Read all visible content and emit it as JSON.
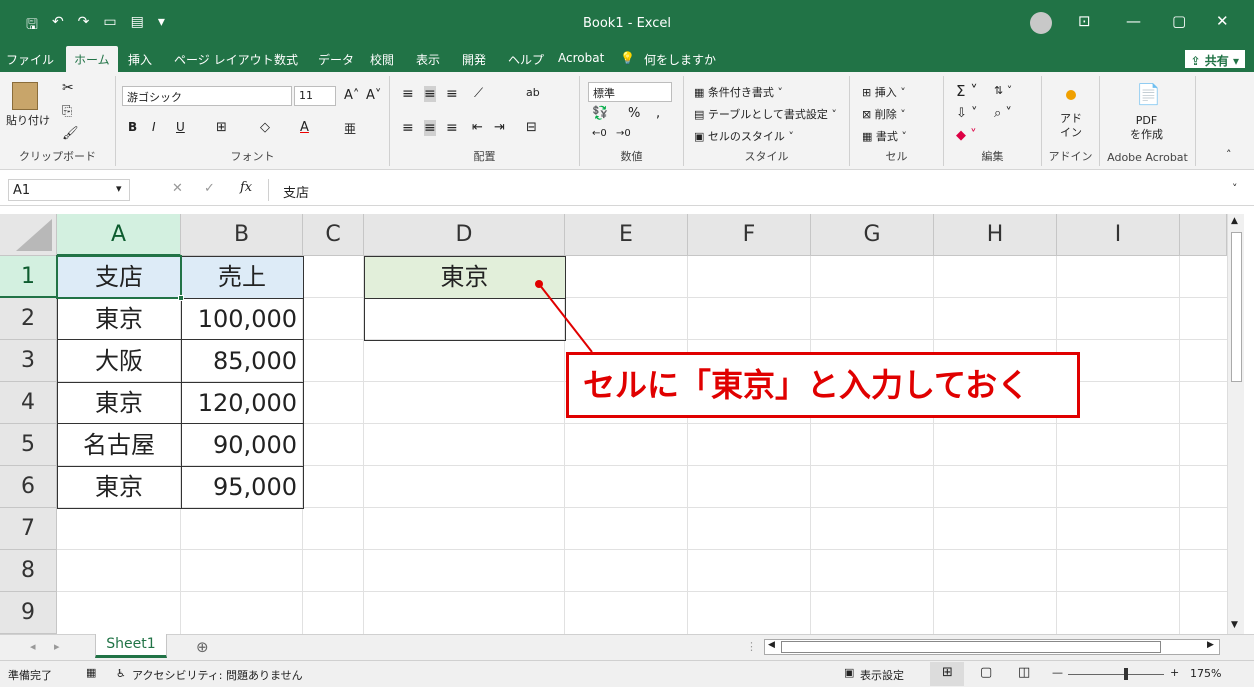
{
  "titlebar": {
    "title": "Book1  -  Excel"
  },
  "menu": {
    "tabs": [
      "ファイル",
      "ホーム",
      "挿入",
      "ページ レイアウト",
      "数式",
      "データ",
      "校閲",
      "表示",
      "開発",
      "ヘルプ",
      "Acrobat"
    ],
    "tell_me": "何をしますか",
    "share": "共有"
  },
  "ribbon": {
    "clipboard": {
      "paste": "貼り付け",
      "label": "クリップボード"
    },
    "font": {
      "name": "游ゴシック",
      "size": "11",
      "label": "フォント"
    },
    "alignment": {
      "label": "配置"
    },
    "number": {
      "format": "標準",
      "label": "数値"
    },
    "styles": {
      "cond": "条件付き書式",
      "table": "テーブルとして書式設定",
      "cell": "セルのスタイル",
      "label": "スタイル"
    },
    "cells": {
      "insert": "挿入",
      "delete": "削除",
      "format": "書式",
      "label": "セル"
    },
    "editing": {
      "label": "編集"
    },
    "addins": {
      "text": "アド\nイン",
      "label": "アドイン"
    },
    "acrobat": {
      "text": "PDF\nを作成",
      "label": "Adobe Acrobat"
    }
  },
  "formula": {
    "namebox": "A1",
    "content": "支店"
  },
  "sheet": {
    "columns": [
      "A",
      "B",
      "C",
      "D",
      "E",
      "F",
      "G",
      "H",
      "I"
    ],
    "rows": [
      "1",
      "2",
      "3",
      "4",
      "5",
      "6",
      "7",
      "8",
      "9"
    ],
    "table": [
      [
        "支店",
        "売上"
      ],
      [
        "東京",
        "100,000"
      ],
      [
        "大阪",
        "85,000"
      ],
      [
        "東京",
        "120,000"
      ],
      [
        "名古屋",
        "90,000"
      ],
      [
        "東京",
        "95,000"
      ]
    ],
    "d1": "東京"
  },
  "annotation": {
    "text": "セルに「東京」と入力しておく"
  },
  "sheet_tab": "Sheet1",
  "status": {
    "ready": "準備完了",
    "accessibility": "アクセシビリティ: 問題ありません",
    "display_settings": "表示設定",
    "zoom": "175%"
  }
}
